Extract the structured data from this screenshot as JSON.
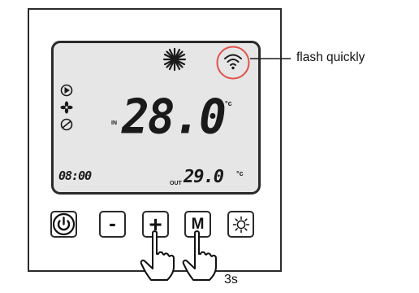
{
  "display": {
    "temperature_main": "28.0",
    "temperature_main_unit": "°c",
    "in_label": "IN",
    "clock": "08:00",
    "out_label": "OUT",
    "temperature_out": "29.0",
    "temperature_out_unit": "°c"
  },
  "status_icons": [
    "sun-icon",
    "wifi-icon",
    "play-icon",
    "fan-icon",
    "valve-icon"
  ],
  "buttons": {
    "power_icon": "power-icon",
    "minus_label": "-",
    "plus_label": "+",
    "mode_label": "M",
    "light_icon": "sun-outline-icon"
  },
  "annotations": {
    "wifi_note": "flash quickly",
    "hold_time": "3s"
  },
  "colors": {
    "highlight_circle": "#e0524a",
    "lcd_background": "#e6e6e6"
  }
}
